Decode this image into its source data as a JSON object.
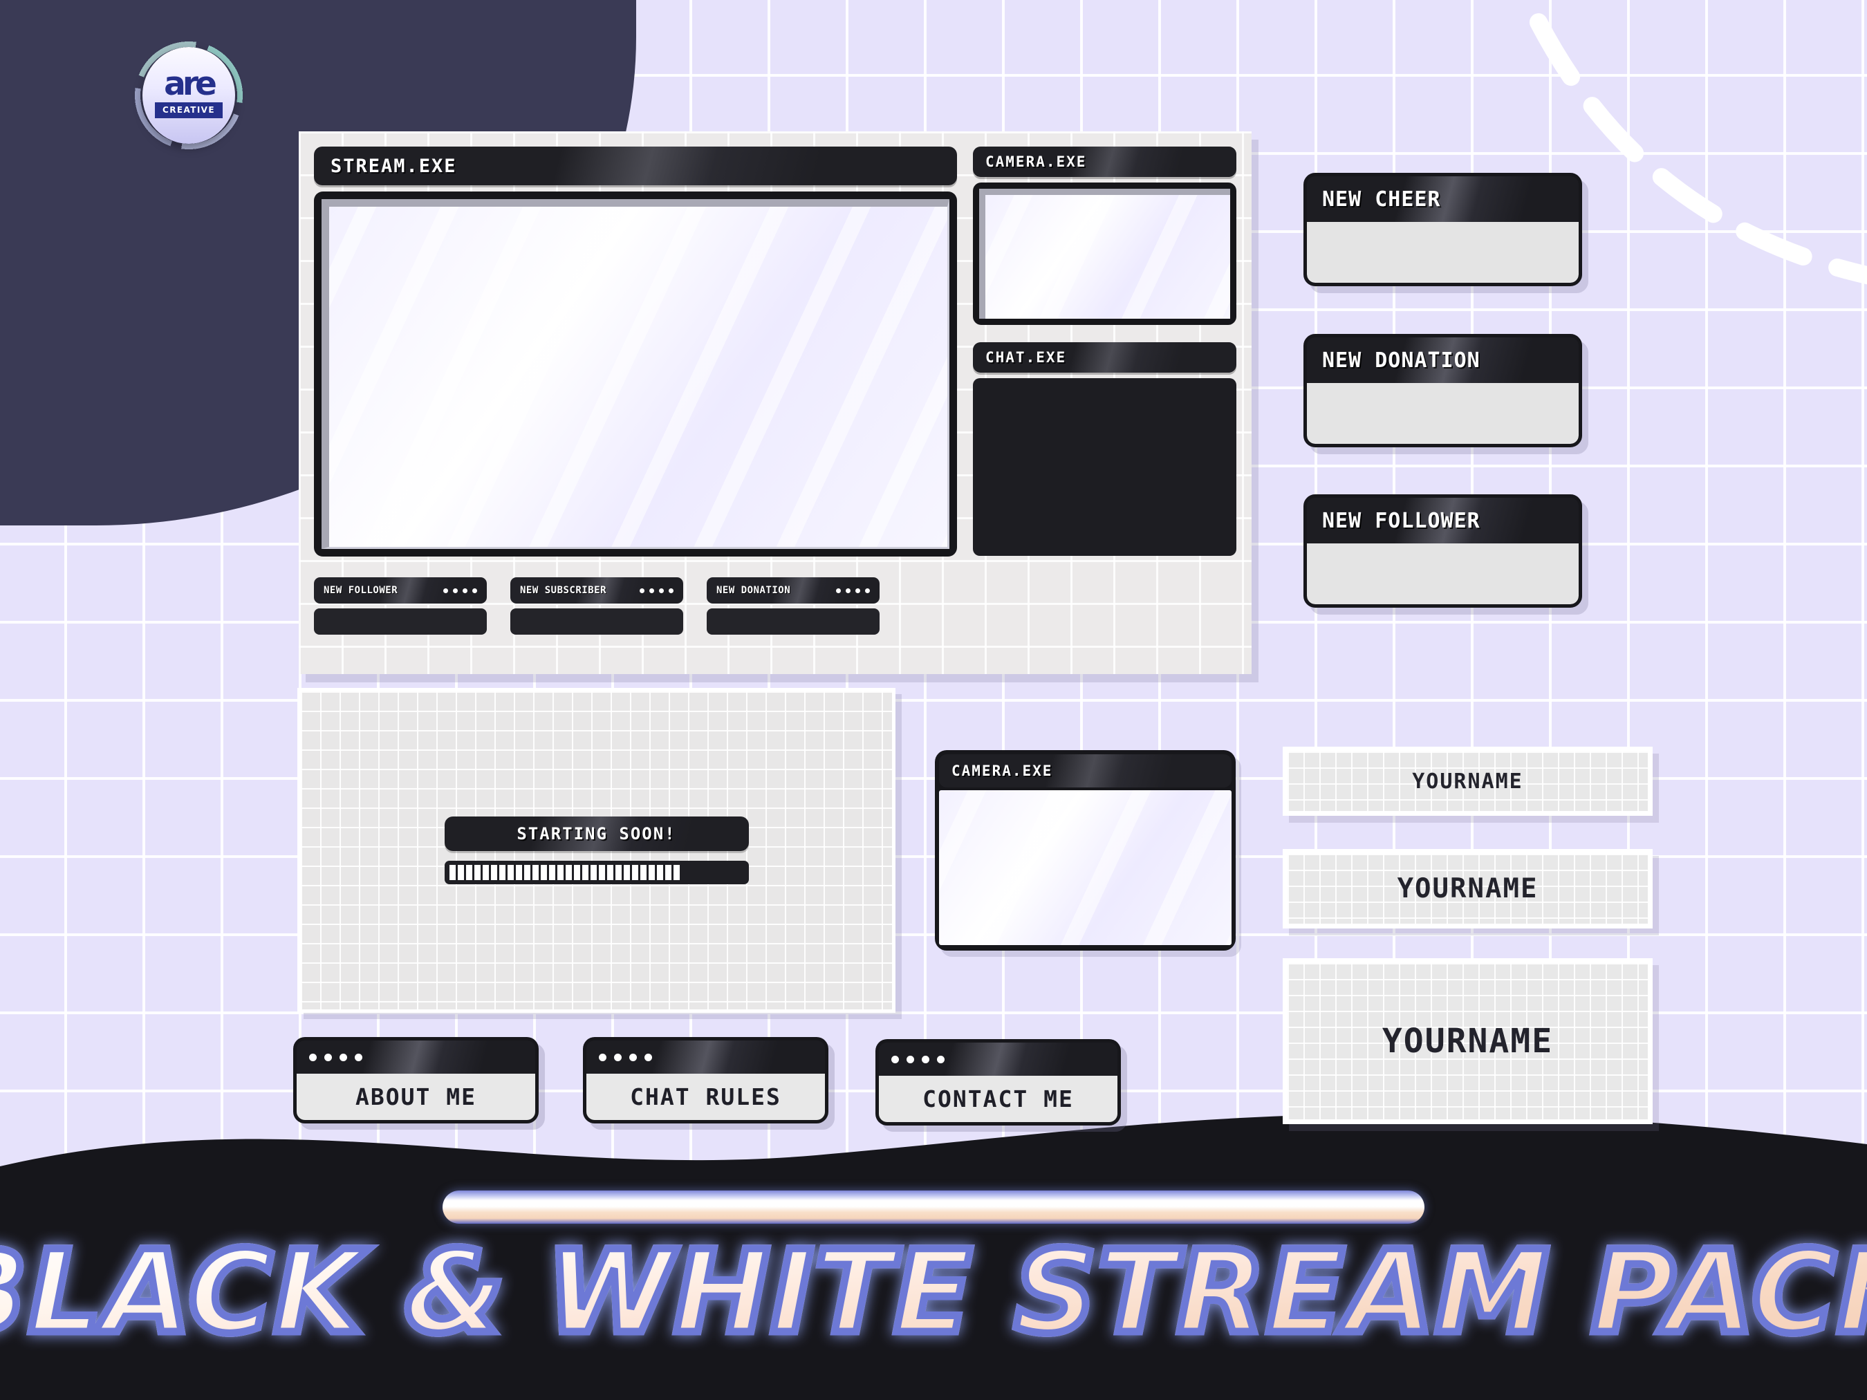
{
  "brand": {
    "logo_mark": "are",
    "logo_sub": "CREATIVE",
    "logo_icon": "are-creative-logo"
  },
  "overlay": {
    "stream_window_title": "STREAM.EXE",
    "camera_window_title": "CAMERA.EXE",
    "chat_window_title": "CHAT.EXE",
    "small_alerts": [
      {
        "label": "NEW FOLLOWER",
        "dots": 4
      },
      {
        "label": "NEW SUBSCRIBER",
        "dots": 4
      },
      {
        "label": "NEW DONATION",
        "dots": 4
      }
    ]
  },
  "alert_cards": [
    {
      "label": "NEW CHEER"
    },
    {
      "label": "NEW DONATION"
    },
    {
      "label": "NEW FOLLOWER"
    }
  ],
  "starting_screen": {
    "label": "STARTING SOON!",
    "progress_segments_filled": 28,
    "progress_segments_total": 36,
    "progress_percent": 78
  },
  "camera_panel": {
    "title": "CAMERA.EXE"
  },
  "panel_buttons": [
    {
      "label": "ABOUT ME",
      "dots": 4
    },
    {
      "label": "CHAT RULES",
      "dots": 4
    },
    {
      "label": "CONTACT ME",
      "dots": 4
    }
  ],
  "name_cards": [
    {
      "label": "YOURNAME",
      "size": "small"
    },
    {
      "label": "YOURNAME",
      "size": "medium"
    },
    {
      "label": "YOURNAME",
      "size": "large"
    }
  ],
  "footer": {
    "title": "BLACK & WHITE STREAM PACK"
  },
  "colors": {
    "background": "#e6e2fb",
    "dark_blob": "#3a3a55",
    "window_dark": "#1f1f24",
    "panel_light": "#e8e8e8",
    "footer_dark": "#16161b",
    "title_outline": "#6d79d6",
    "logo_blue": "#25308c"
  }
}
